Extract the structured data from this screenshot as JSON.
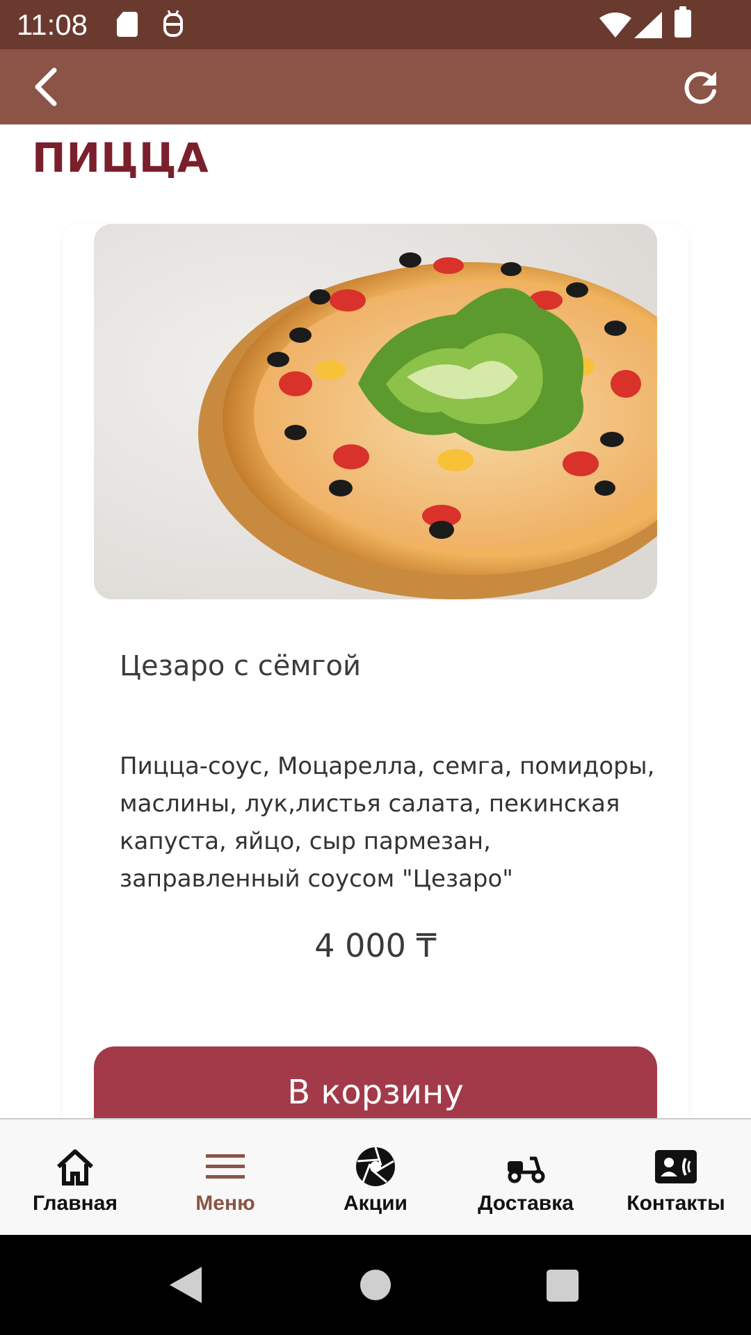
{
  "status_bar": {
    "time": "11:08",
    "icons": [
      "sd-card-icon",
      "android-debug-icon",
      "wifi-icon",
      "signal-icon",
      "battery-icon"
    ]
  },
  "app_bar": {
    "back_icon": "back-chevron-icon",
    "refresh_icon": "refresh-icon",
    "background_color": "#8b5446"
  },
  "section": {
    "title": "ПИЦЦА",
    "title_color": "#7a1f2b"
  },
  "product": {
    "image_icon": "pizza-photo",
    "name": "Цезаро с сёмгой",
    "description": "Пицца-соус, Моцарелла, семга, помидоры, маслины, лук,листья салата, пекинская капуста, яйцо, сыр пармезан, заправленный соусом \"Цезаро\"",
    "price": "4 000 ₸",
    "add_to_cart_label": "В корзину",
    "button_color": "#a23a4a"
  },
  "bottom_nav": {
    "items": [
      {
        "label": "Главная",
        "icon": "home-icon",
        "active": false
      },
      {
        "label": "Меню",
        "icon": "menu-icon",
        "active": true
      },
      {
        "label": "Акции",
        "icon": "aperture-icon",
        "active": false
      },
      {
        "label": "Доставка",
        "icon": "scooter-icon",
        "active": false
      },
      {
        "label": "Контакты",
        "icon": "contact-card-icon",
        "active": false
      }
    ],
    "active_color": "#8b5446"
  },
  "system_nav": {
    "icons": [
      "system-back-icon",
      "system-home-icon",
      "system-recents-icon"
    ]
  }
}
